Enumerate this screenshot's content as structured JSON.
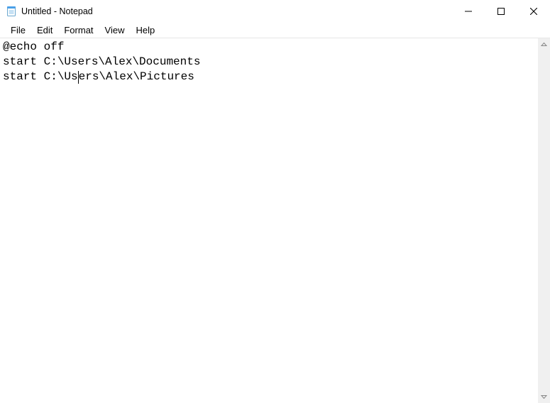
{
  "window": {
    "title": "Untitled - Notepad"
  },
  "menu": {
    "file": "File",
    "edit": "Edit",
    "format": "Format",
    "view": "View",
    "help": "Help"
  },
  "editor": {
    "lines": [
      "@echo off",
      "start C:\\Users\\Alex\\Documents",
      "start C:\\Users\\Alex\\Pictures"
    ],
    "caret": {
      "line": 2,
      "pre": "start C:\\Us",
      "post": "ers\\Alex\\Pictures"
    }
  }
}
